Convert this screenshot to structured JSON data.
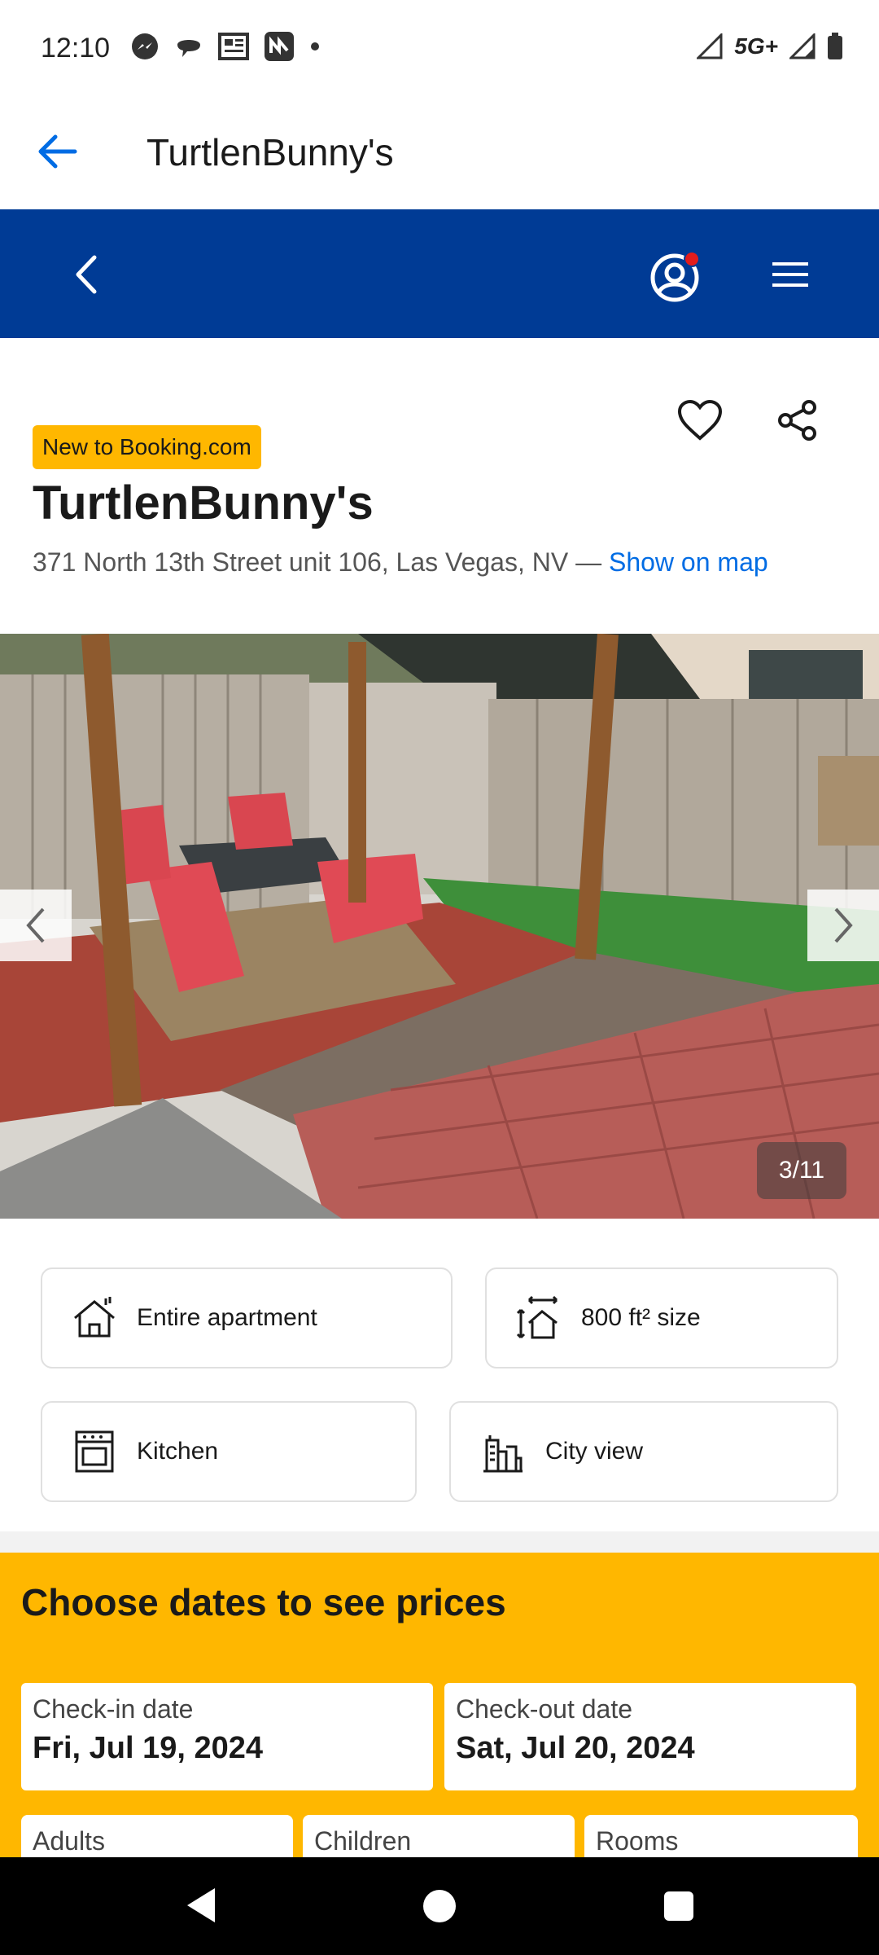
{
  "status_bar": {
    "time": "12:10",
    "network": "5G+",
    "icons": [
      "messenger-icon",
      "chat-icon",
      "news-icon",
      "app-icon",
      "dot-icon",
      "signal-icon",
      "signal-icon",
      "battery-icon"
    ]
  },
  "app_bar": {
    "title": "TurtlenBunny's",
    "back_icon": "arrow-left-icon"
  },
  "site_header": {
    "back_icon": "chevron-left-icon",
    "profile_icon": "account-icon",
    "menu_icon": "hamburger-icon",
    "brand_color": "#003b95",
    "notification_color": "#e21c1c"
  },
  "property": {
    "badge": "New to Booking.com",
    "name": "TurtlenBunny's",
    "address": "371 North 13th Street unit 106, Las Vegas, NV —",
    "map_link": "Show on map",
    "favorite_icon": "heart-icon",
    "share_icon": "share-icon"
  },
  "gallery": {
    "counter": "3/11",
    "prev_icon": "chevron-left-icon",
    "next_icon": "chevron-right-icon"
  },
  "facilities": [
    {
      "label": "Entire apartment",
      "icon": "house-icon"
    },
    {
      "label": "800 ft² size",
      "icon": "size-icon"
    },
    {
      "label": "Kitchen",
      "icon": "kitchen-icon"
    },
    {
      "label": "City view",
      "icon": "city-icon"
    }
  ],
  "dates": {
    "heading": "Choose dates to see prices",
    "checkin_label": "Check-in date",
    "checkin_value": "Fri, Jul 19, 2024",
    "checkout_label": "Check-out date",
    "checkout_value": "Sat, Jul 20, 2024",
    "adults_label": "Adults",
    "children_label": "Children",
    "rooms_label": "Rooms",
    "accent_color": "#ffb700"
  },
  "nav": {
    "back_icon": "triangle-back-icon",
    "home_icon": "circle-home-icon",
    "recents_icon": "square-recents-icon"
  }
}
